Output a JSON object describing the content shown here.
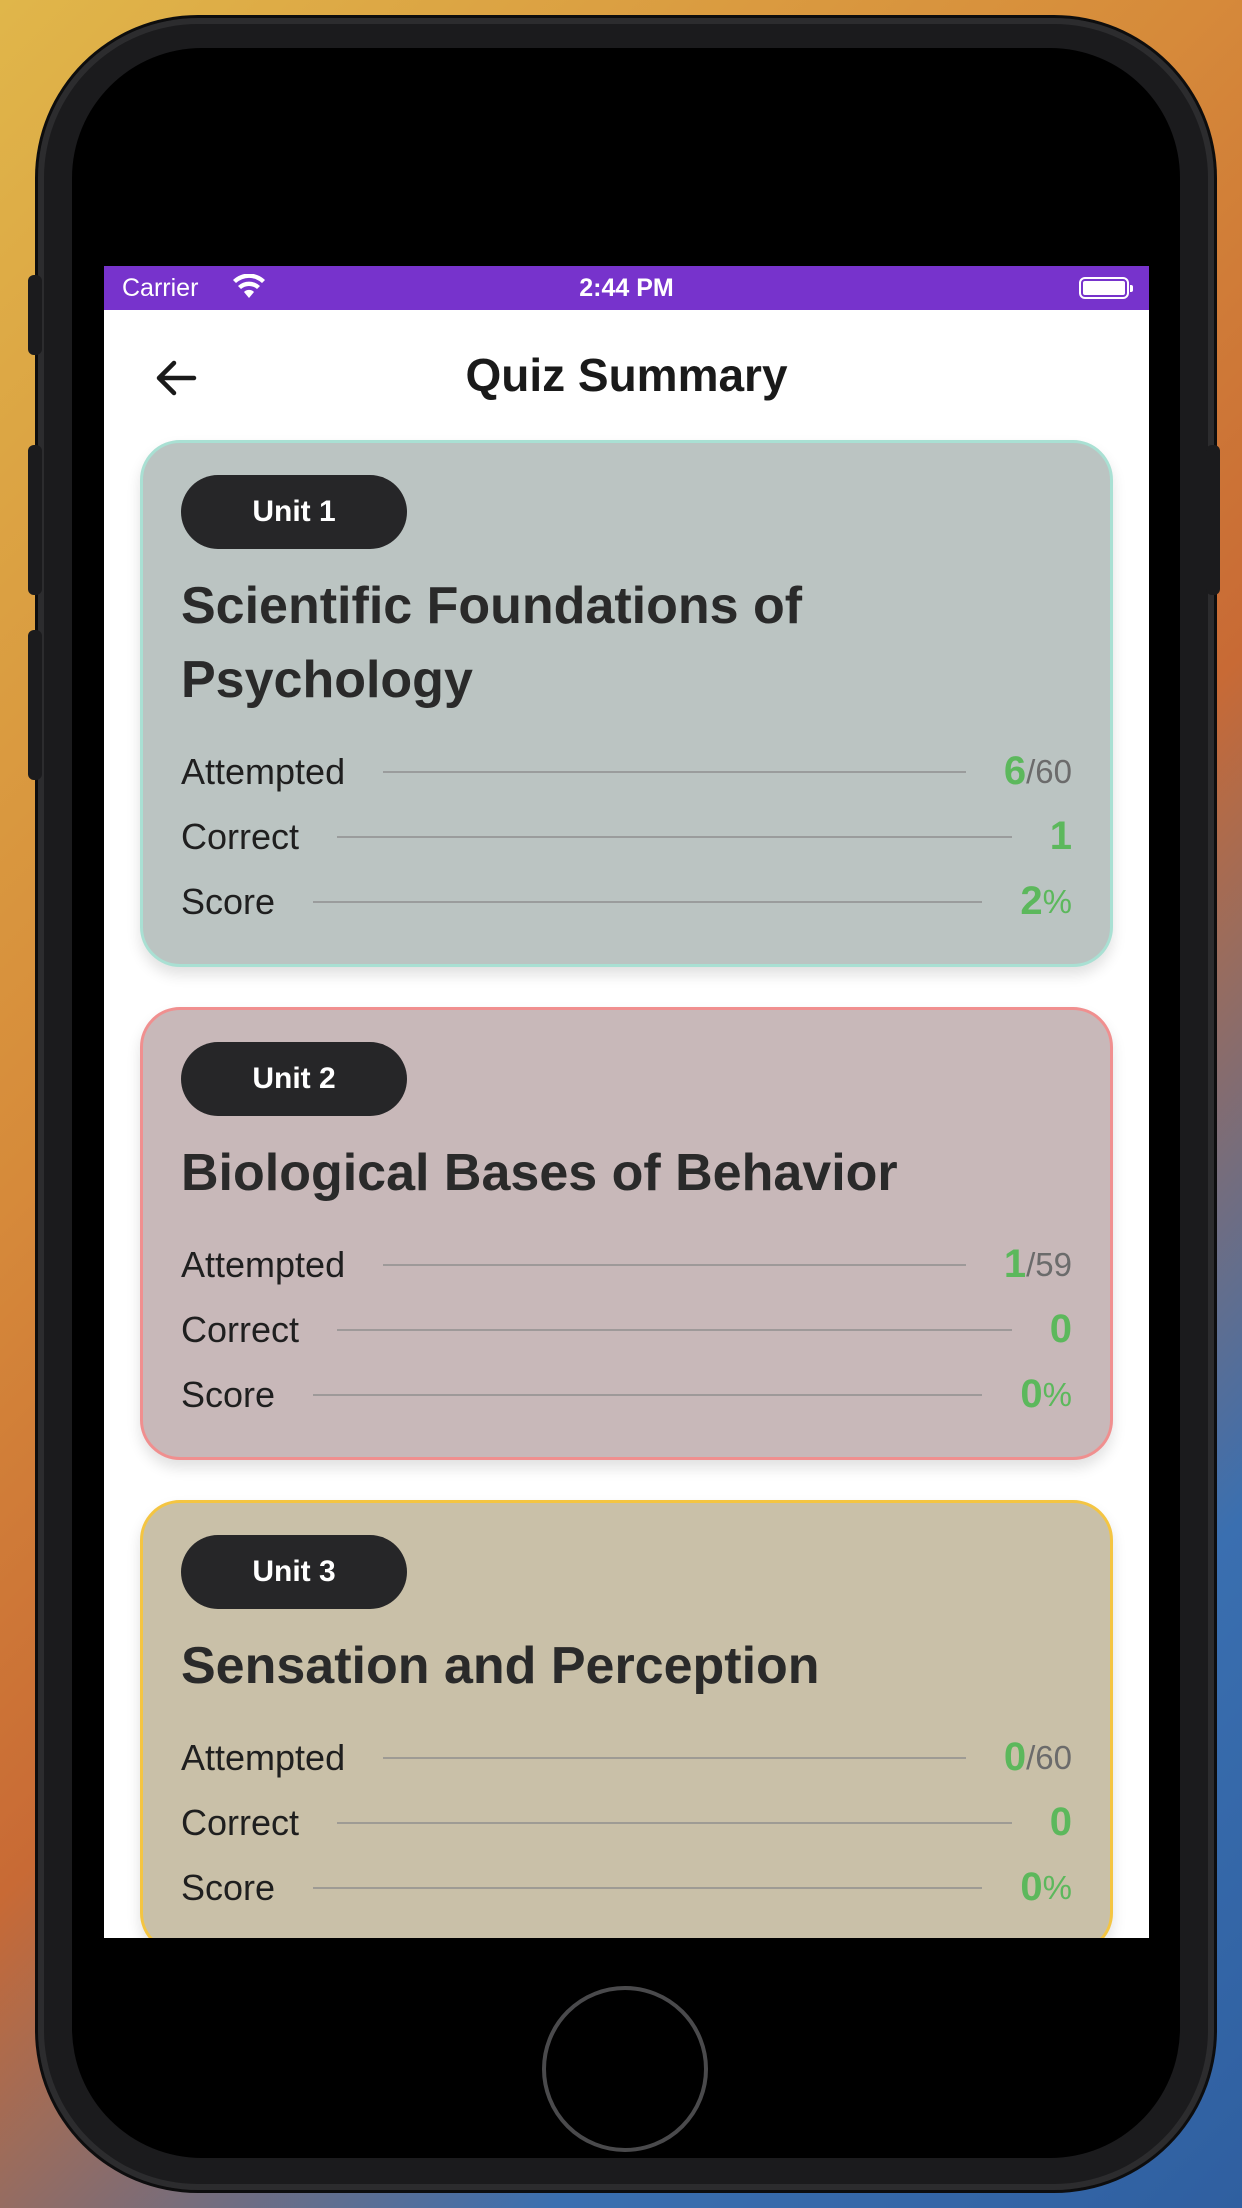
{
  "status_bar": {
    "carrier": "Carrier",
    "time": "2:44 PM",
    "bar_color": "#7733cc"
  },
  "nav": {
    "title": "Quiz Summary",
    "back_icon": "arrow-left-icon"
  },
  "units": [
    {
      "badge": "Unit 1",
      "title": "Scientific Foundations of Psychology",
      "bg": "#bbc4c2",
      "border": "#a9e0d3",
      "attempted_label": "Attempted",
      "attempted": "6",
      "total": "/60",
      "correct_label": "Correct",
      "correct": "1",
      "score_label": "Score",
      "score": "2",
      "score_unit": "%"
    },
    {
      "badge": "Unit 2",
      "title": "Biological Bases of Behavior",
      "bg": "#c8b8b9",
      "border": "#f08f8f",
      "attempted_label": "Attempted",
      "attempted": "1",
      "total": "/59",
      "correct_label": "Correct",
      "correct": "0",
      "score_label": "Score",
      "score": "0",
      "score_unit": "%"
    },
    {
      "badge": "Unit 3",
      "title": "Sensation and Perception",
      "bg": "#c9c0a8",
      "border": "#f4c542",
      "attempted_label": "Attempted",
      "attempted": "0",
      "total": "/60",
      "correct_label": "Correct",
      "correct": "0",
      "score_label": "Score",
      "score": "0",
      "score_unit": "%"
    }
  ]
}
